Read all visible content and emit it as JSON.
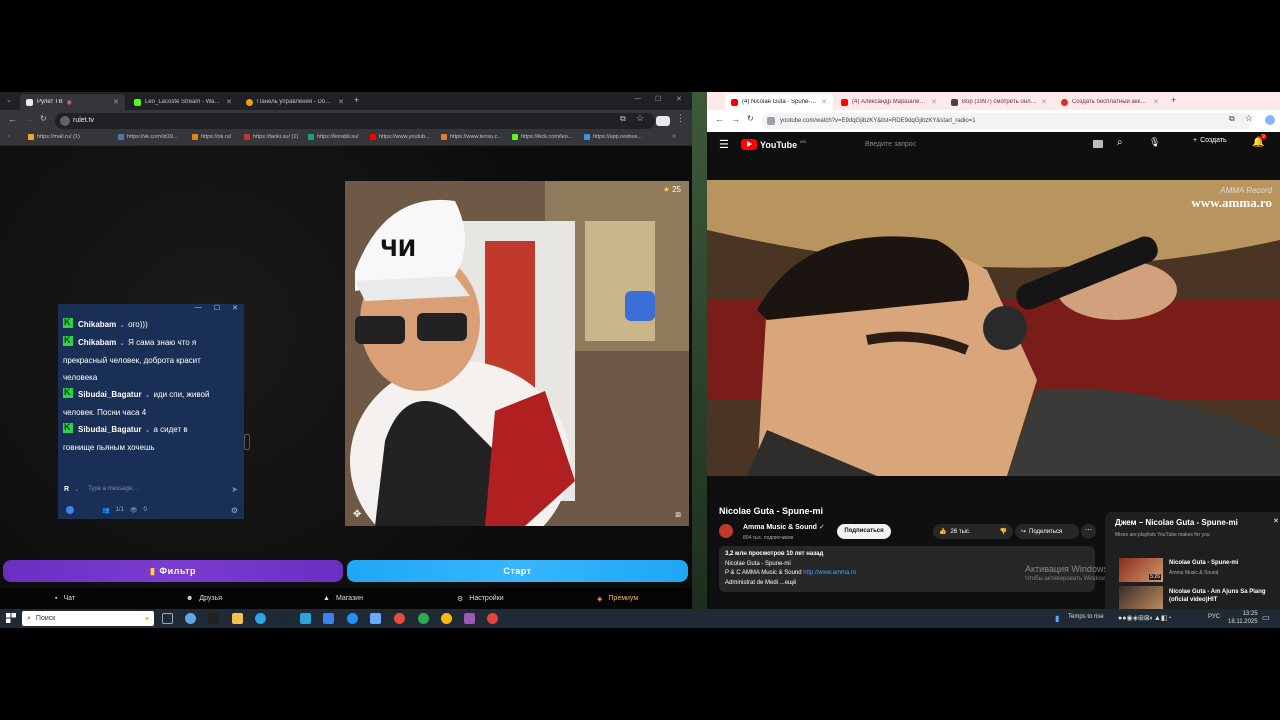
{
  "left_browser": {
    "tabs": [
      {
        "title": "Рулет ТВ",
        "active": true
      },
      {
        "title": "Leo_Lacoste Stream - Watch Li..."
      },
      {
        "title": "Панель управления - Donatio..."
      }
    ],
    "url": "rulet.tv",
    "bookmarks": [
      "https://mail.ru/ (1)",
      "https://vk.com/id19...",
      "https://ok.ru/",
      "https://tanki.su/ (1)",
      "https://korabli.su/",
      "https://www.youtub...",
      "https://www.tensu.c...",
      "https://kick.com/leo...",
      "https://app.restrea..."
    ]
  },
  "chat": {
    "messages": [
      {
        "user": "Chikabam",
        "text": "ого)))"
      },
      {
        "user": "Chikabam",
        "text": "Я сама знаю что я",
        "cont": [
          "прекрасный человек, доброта красит",
          "человека"
        ]
      },
      {
        "user": "Sibudai_Bagatur",
        "text": "иди спи, живой",
        "cont": [
          "человек. Посни часа 4"
        ]
      },
      {
        "user": "Sibudai_Bagatur",
        "text": "а сидет в",
        "cont": [
          "говнище пьяным хочешь"
        ]
      }
    ],
    "input_avatar": "R",
    "input_placeholder": "Type a message...",
    "viewers": "1/1",
    "watching": "0"
  },
  "cam": {
    "star_count": "25"
  },
  "buttons": {
    "filter": "Фильтр",
    "start": "Старт"
  },
  "nav": {
    "chat": "Чат",
    "friends": "Друзья",
    "shop": "Магазин",
    "settings": "Настройки",
    "premium": "Премиум"
  },
  "right_browser": {
    "tabs": [
      {
        "title": "(4) Nicolae Guta - Spune-mi - Y...",
        "active": true
      },
      {
        "title": "(4) Александр Маршалемый с..."
      },
      {
        "title": "Вор (1997) смотреть онлайн б..."
      },
      {
        "title": "Создать бесплатный аккаунт ..."
      }
    ],
    "url": "youtube.com/watch?v=E9dqGjibzKY&list=RDE9dqGjibzKY&start_radio=1"
  },
  "youtube": {
    "logo": "YouTube",
    "logo_badge": "MD",
    "search_placeholder": "Введите запрос",
    "create": "Создать",
    "notif_count": "9",
    "watermark_line1": "AMMA Record",
    "watermark_line2": "www.amma.ro",
    "video_title": "Nicolae Guta - Spune-mi",
    "channel": "Amma Music & Sound",
    "subscribers": "804 тыс. подписчиков",
    "subscribe": "Подписаться",
    "likes": "26 тыс.",
    "share": "Поделиться",
    "views_line": "3,2 млн просмотров  10 лет назад",
    "desc_lines": [
      "Nicolae Guta - Spune-mi",
      "P & C AMMA Music & Sound"
    ],
    "desc_link": "http://www.amma.ro",
    "desc_last": "Administrat de  Medi ...ещё",
    "activation_title": "Активация Windows",
    "activation_sub": "Чтобы активировать Windows, перейдите в раздел \"Параметры\".",
    "playlist_title": "Джем – Nicolae Guta - Spune-mi",
    "playlist_sub": "Mixes are playlists YouTube makes for you",
    "playlist_items": [
      {
        "title": "Nicolae Guta - Spune-mi",
        "channel": "Amma Music & Sound",
        "duration": "5:26"
      },
      {
        "title": "Nicolae Guta - Am Ajuns Sa Plang (oficial video)HIT",
        "channel": "",
        "duration": ""
      }
    ]
  },
  "taskbar": {
    "search": "Поиск",
    "weather": "Temps to rise",
    "lang": "РУС",
    "time": "13:25",
    "date": "18.11.2025"
  }
}
